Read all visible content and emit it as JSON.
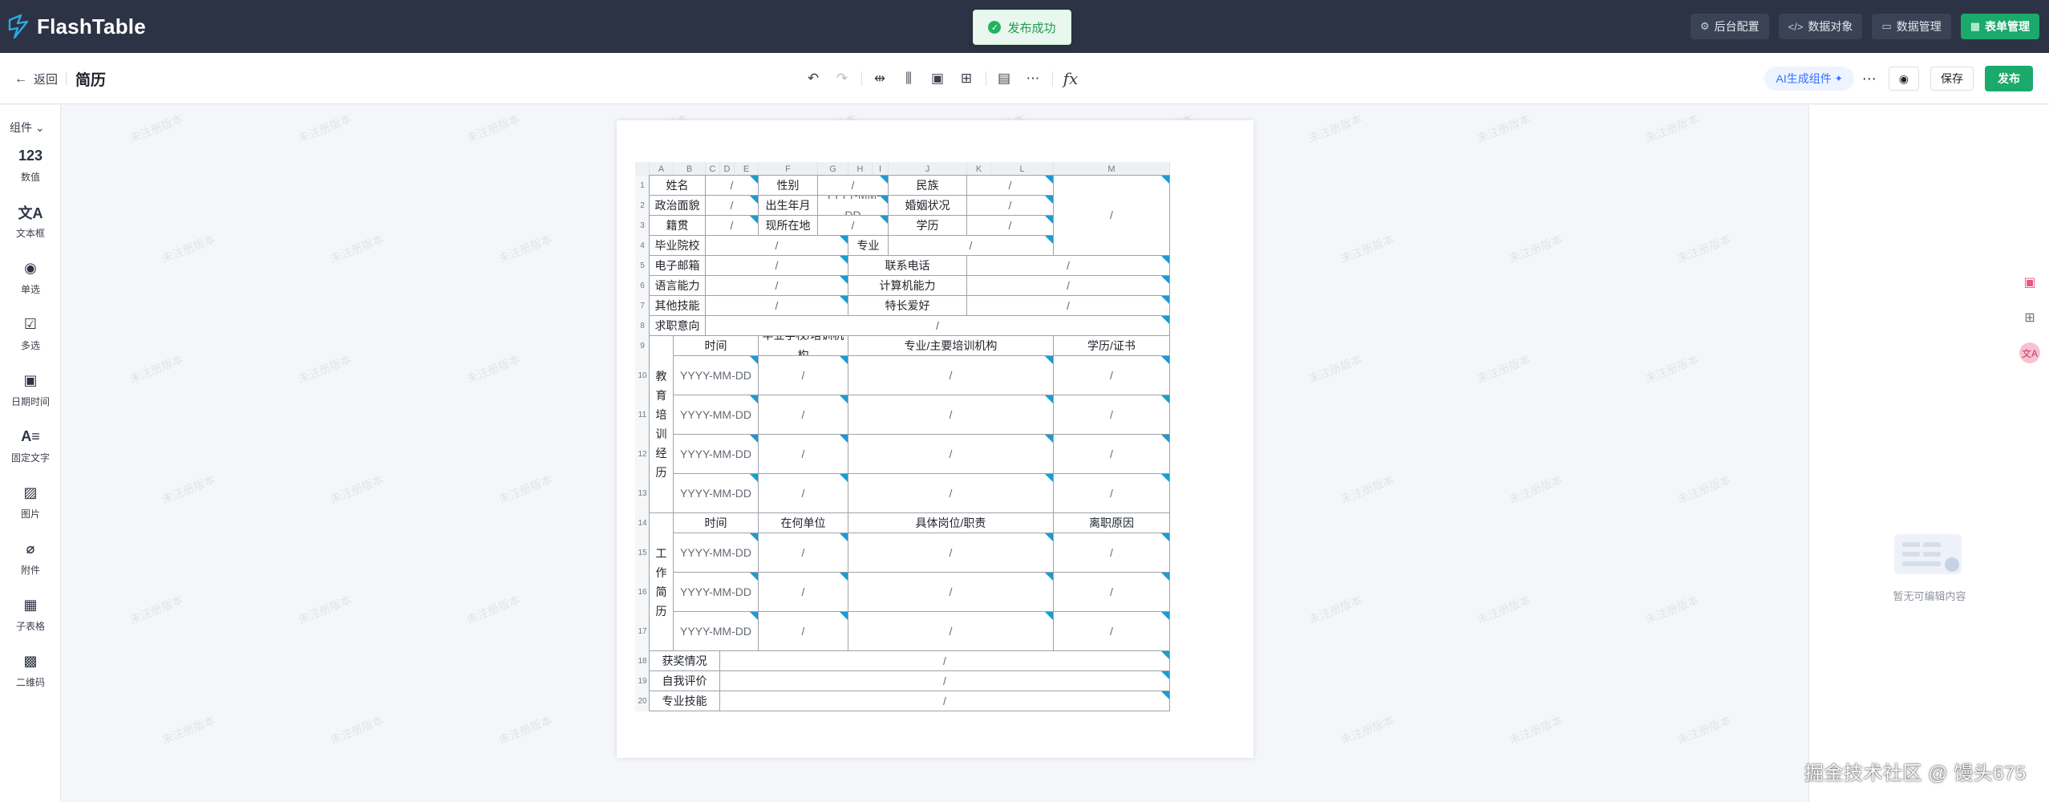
{
  "app": {
    "name": "FlashTable"
  },
  "toast": {
    "text": "发布成功"
  },
  "topnav": [
    {
      "label": "后台配置",
      "icon": "gear-icon"
    },
    {
      "label": "数据对象",
      "icon": "code-icon"
    },
    {
      "label": "数据管理",
      "icon": "box-icon"
    },
    {
      "label": "表单管理",
      "icon": "grid-icon"
    }
  ],
  "subbar": {
    "back_label": "返回",
    "title": "简历",
    "ai_label": "AI生成组件",
    "save_label": "保存",
    "publish_label": "发布"
  },
  "sidebar": {
    "header": "组件",
    "items": [
      {
        "label": "数值",
        "icon": "number-icon",
        "glyph": "123"
      },
      {
        "label": "文本框",
        "icon": "text-icon",
        "glyph": "文A"
      },
      {
        "label": "单选",
        "icon": "radio-icon",
        "glyph": "◉"
      },
      {
        "label": "多选",
        "icon": "checkbox-icon",
        "glyph": "☑"
      },
      {
        "label": "日期时间",
        "icon": "calendar-icon",
        "glyph": "▣"
      },
      {
        "label": "固定文字",
        "icon": "fixed-text-icon",
        "glyph": "A≡"
      },
      {
        "label": "图片",
        "icon": "image-icon",
        "glyph": "▨"
      },
      {
        "label": "附件",
        "icon": "paperclip-icon",
        "glyph": "⌀"
      },
      {
        "label": "子表格",
        "icon": "subtable-icon",
        "glyph": "▦"
      },
      {
        "label": "二维码",
        "icon": "qrcode-icon",
        "glyph": "▩"
      }
    ]
  },
  "right_panel": {
    "empty_text": "暂无可编辑内容"
  },
  "watermark_text": "未注册版本",
  "footer_tag": "掘金技术社区 @ 馒头675",
  "sheet": {
    "columns": [
      "A",
      "B",
      "C",
      "D",
      "E",
      "F",
      "G",
      "H",
      "I",
      "J",
      "K",
      "L",
      "M"
    ],
    "rows": [
      "1",
      "2",
      "3",
      "4",
      "5",
      "6",
      "7",
      "8",
      "9",
      "10",
      "11",
      "12",
      "13",
      "14",
      "15",
      "16",
      "17",
      "18",
      "19",
      "20"
    ],
    "placeholder": "/",
    "date_placeholder": "YYYY-MM-DD",
    "labels": {
      "name": "姓名",
      "gender": "性别",
      "ethnicity": "民族",
      "politics": "政治面貌",
      "birth": "出生年月",
      "marital": "婚姻状况",
      "native": "籍贯",
      "residence": "现所在地",
      "degree": "学历",
      "school": "毕业院校",
      "major": "专业",
      "email": "电子邮箱",
      "phone": "联系电话",
      "language": "语言能力",
      "computer": "计算机能力",
      "other_skills": "其他技能",
      "hobbies": "特长爱好",
      "intention": "求职意向",
      "edu_group": "教育培训经历",
      "time": "时间",
      "edu_school": "毕业学校/培训机构",
      "edu_major": "专业/主要培训机构",
      "edu_cert": "学历/证书",
      "work_group": "工作简历",
      "work_unit": "在何单位",
      "work_post": "具体岗位/职责",
      "work_reason": "离职原因",
      "awards": "获奖情况",
      "self_eval": "自我评价",
      "pro_skills": "专业技能"
    }
  }
}
